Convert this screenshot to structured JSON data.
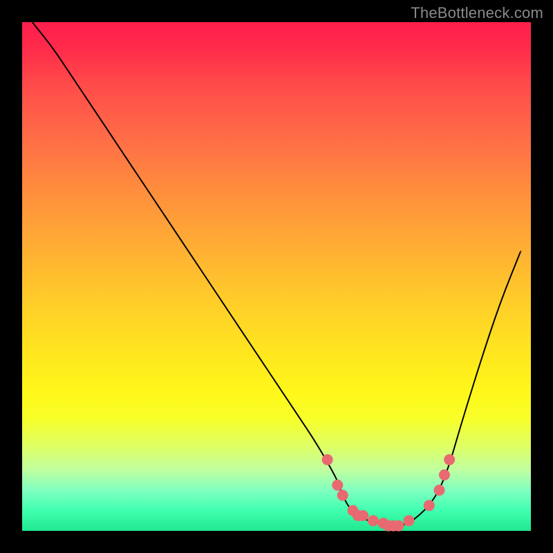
{
  "watermark": "TheBottleneck.com",
  "chart_data": {
    "type": "line",
    "title": "",
    "xlabel": "",
    "ylabel": "",
    "xlim": [
      0,
      100
    ],
    "ylim": [
      0,
      100
    ],
    "grid": false,
    "legend": false,
    "series": [
      {
        "name": "bottleneck-curve",
        "x": [
          2,
          6,
          10,
          14,
          18,
          22,
          26,
          30,
          34,
          38,
          42,
          46,
          50,
          54,
          58,
          62,
          63,
          64,
          65,
          66,
          68,
          70,
          72,
          74,
          76,
          78,
          80,
          82,
          84,
          86,
          90,
          94,
          98
        ],
        "y": [
          100,
          95,
          89,
          83,
          77,
          71,
          65,
          59,
          53,
          47,
          41,
          35,
          29,
          23,
          17,
          10,
          7,
          5,
          4,
          3,
          2,
          1.5,
          1,
          1,
          1.5,
          3,
          5,
          8,
          13,
          20,
          33,
          45,
          55
        ]
      }
    ],
    "markers": {
      "name": "sample-points",
      "x": [
        60,
        62,
        63,
        65,
        66,
        67,
        69,
        71,
        72,
        73,
        74,
        76,
        80,
        82,
        83,
        84
      ],
      "y": [
        14,
        9,
        7,
        4,
        3,
        3,
        2,
        1.5,
        1,
        1,
        1,
        2,
        5,
        8,
        11,
        14
      ]
    }
  }
}
